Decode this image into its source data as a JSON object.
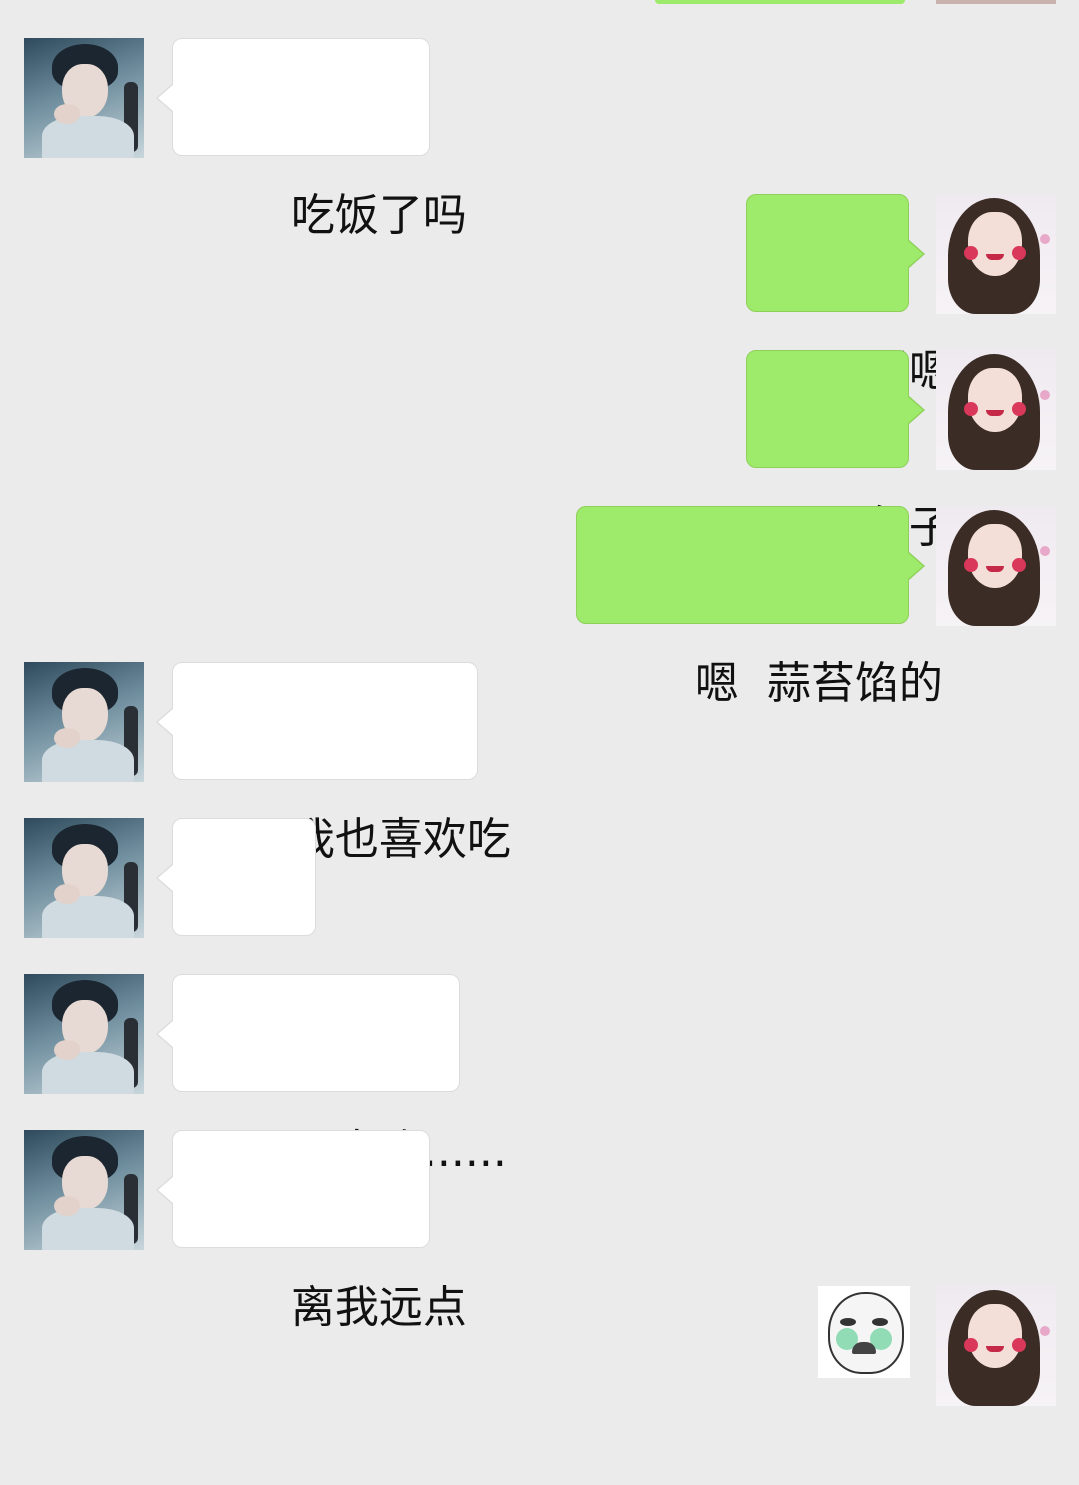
{
  "messages": [
    {
      "side": "in",
      "text": "吃饭了吗"
    },
    {
      "side": "out",
      "text": "嗯嗯"
    },
    {
      "side": "out",
      "text": "包子"
    },
    {
      "side": "out",
      "text": "嗯  蒜苔馅的"
    },
    {
      "side": "in",
      "text": "我也喜欢吃"
    },
    {
      "side": "in",
      "text": "......"
    },
    {
      "side": "in",
      "text": "不喜欢......"
    },
    {
      "side": "in",
      "text": "离我远点"
    },
    {
      "side": "out",
      "sticker": "crying-face-sticker"
    }
  ],
  "colors": {
    "background": "#ebebeb",
    "incoming_bubble": "#ffffff",
    "outgoing_bubble": "#9eea6a"
  },
  "icons": {
    "contact_avatar": "male-avatar",
    "self_avatar": "female-avatar",
    "sticker": "crying-face-sticker"
  }
}
